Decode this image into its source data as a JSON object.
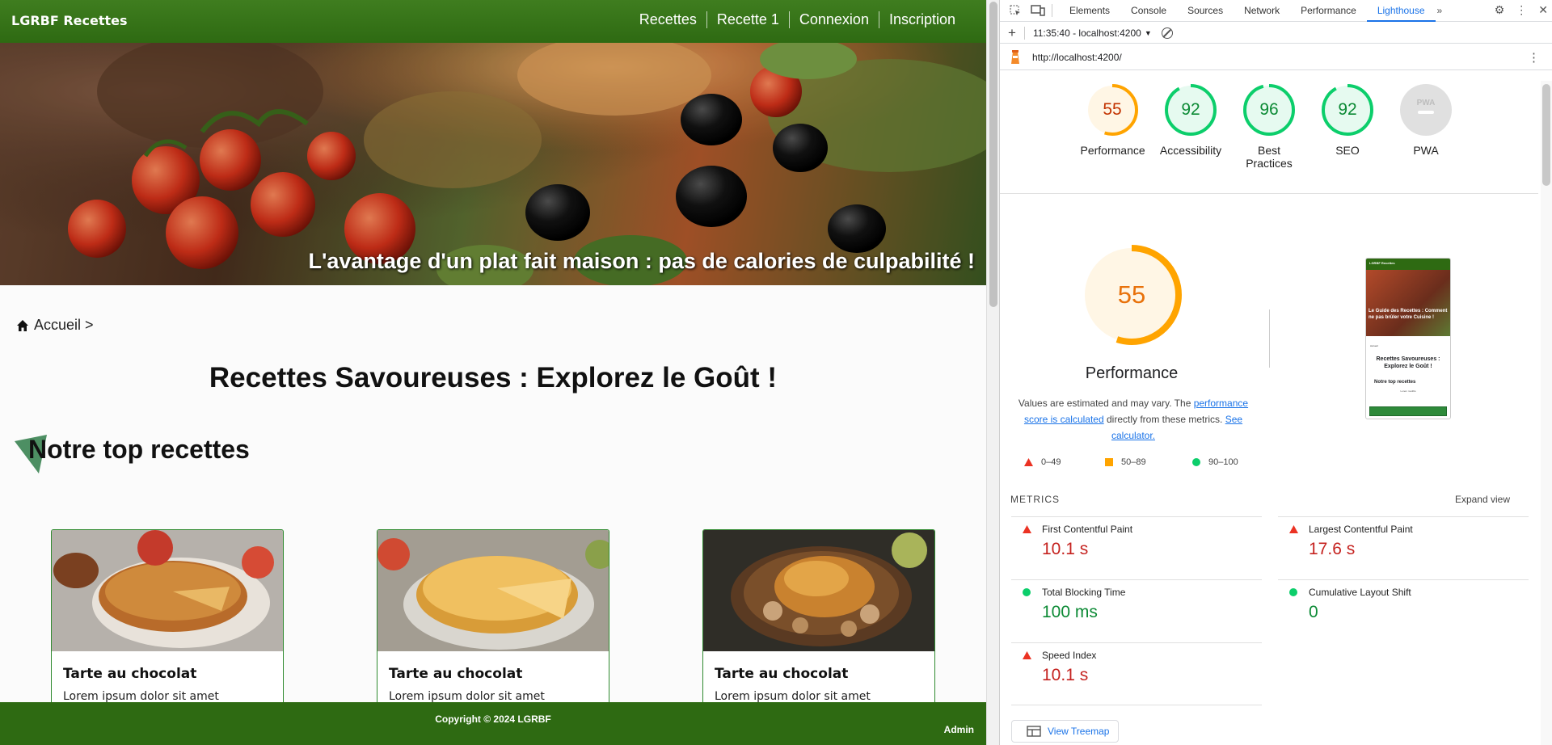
{
  "app": {
    "brand": "LGRBF Recettes",
    "nav": [
      "Recettes",
      "Recette 1",
      "Connexion",
      "Inscription"
    ],
    "hero_text": "L'avantage d'un plat fait maison : pas de calories de culpabilité !",
    "breadcrumb": "Accueil >",
    "title": "Recettes Savoureuses : Explorez le Goût !",
    "section_title": "Notre top recettes",
    "cards": [
      {
        "title": "Tarte au chocolat",
        "desc": "Lorem ipsum dolor sit amet"
      },
      {
        "title": "Tarte au chocolat",
        "desc": "Lorem ipsum dolor sit amet"
      },
      {
        "title": "Tarte au chocolat",
        "desc": "Lorem ipsum dolor sit amet"
      }
    ],
    "footer_copyright": "Copyright © 2024 LGRBF",
    "footer_admin": "Admin"
  },
  "devtools": {
    "tabs": [
      "Elements",
      "Console",
      "Sources",
      "Network",
      "Performance",
      "Lighthouse"
    ],
    "active_tab": "Lighthouse",
    "report_select": "11:35:40 - localhost:4200",
    "url": "http://localhost:4200/",
    "gauges": [
      {
        "score": "55",
        "label": "Performance",
        "value": 55,
        "color": "#ffa400"
      },
      {
        "score": "92",
        "label": "Accessibility",
        "value": 92,
        "color": "#0cce6b"
      },
      {
        "score": "96",
        "label": "Best Practices",
        "value": 96,
        "color": "#0cce6b"
      },
      {
        "score": "92",
        "label": "SEO",
        "value": 92,
        "color": "#0cce6b"
      },
      {
        "score": "PWA",
        "label": "PWA",
        "value": 0,
        "color": "#9e9e9e"
      }
    ],
    "performance": {
      "score": "55",
      "title": "Performance",
      "desc_pre": "Values are estimated and may vary. The ",
      "desc_link1": "performance score is calculated",
      "desc_mid": " directly from these metrics. ",
      "desc_link2": "See calculator."
    },
    "thumbnail": {
      "brand": "LGRBF Recettes",
      "hero": "Le Guide des Recettes : Comment ne pas brûler votre Cuisine !",
      "crumb": "Accueil",
      "title": "Recettes Savoureuses : Explorez le Goût !",
      "section": "Notre top recettes",
      "foot": "Lorem modifié"
    },
    "legend": [
      "0–49",
      "50–89",
      "90–100"
    ],
    "metrics_header": "METRICS",
    "expand_view": "Expand view",
    "metrics": [
      {
        "label": "First Contentful Paint",
        "value": "10.1 s",
        "status": "bad"
      },
      {
        "label": "Largest Contentful Paint",
        "value": "17.6 s",
        "status": "bad"
      },
      {
        "label": "Total Blocking Time",
        "value": "100 ms",
        "status": "good"
      },
      {
        "label": "Cumulative Layout Shift",
        "value": "0",
        "status": "good"
      },
      {
        "label": "Speed Index",
        "value": "10.1 s",
        "status": "bad"
      }
    ],
    "view_treemap": "View Treemap",
    "colors": {
      "bad": "#c5221f",
      "average": "#ffa400",
      "good": "#0c8a35"
    }
  }
}
